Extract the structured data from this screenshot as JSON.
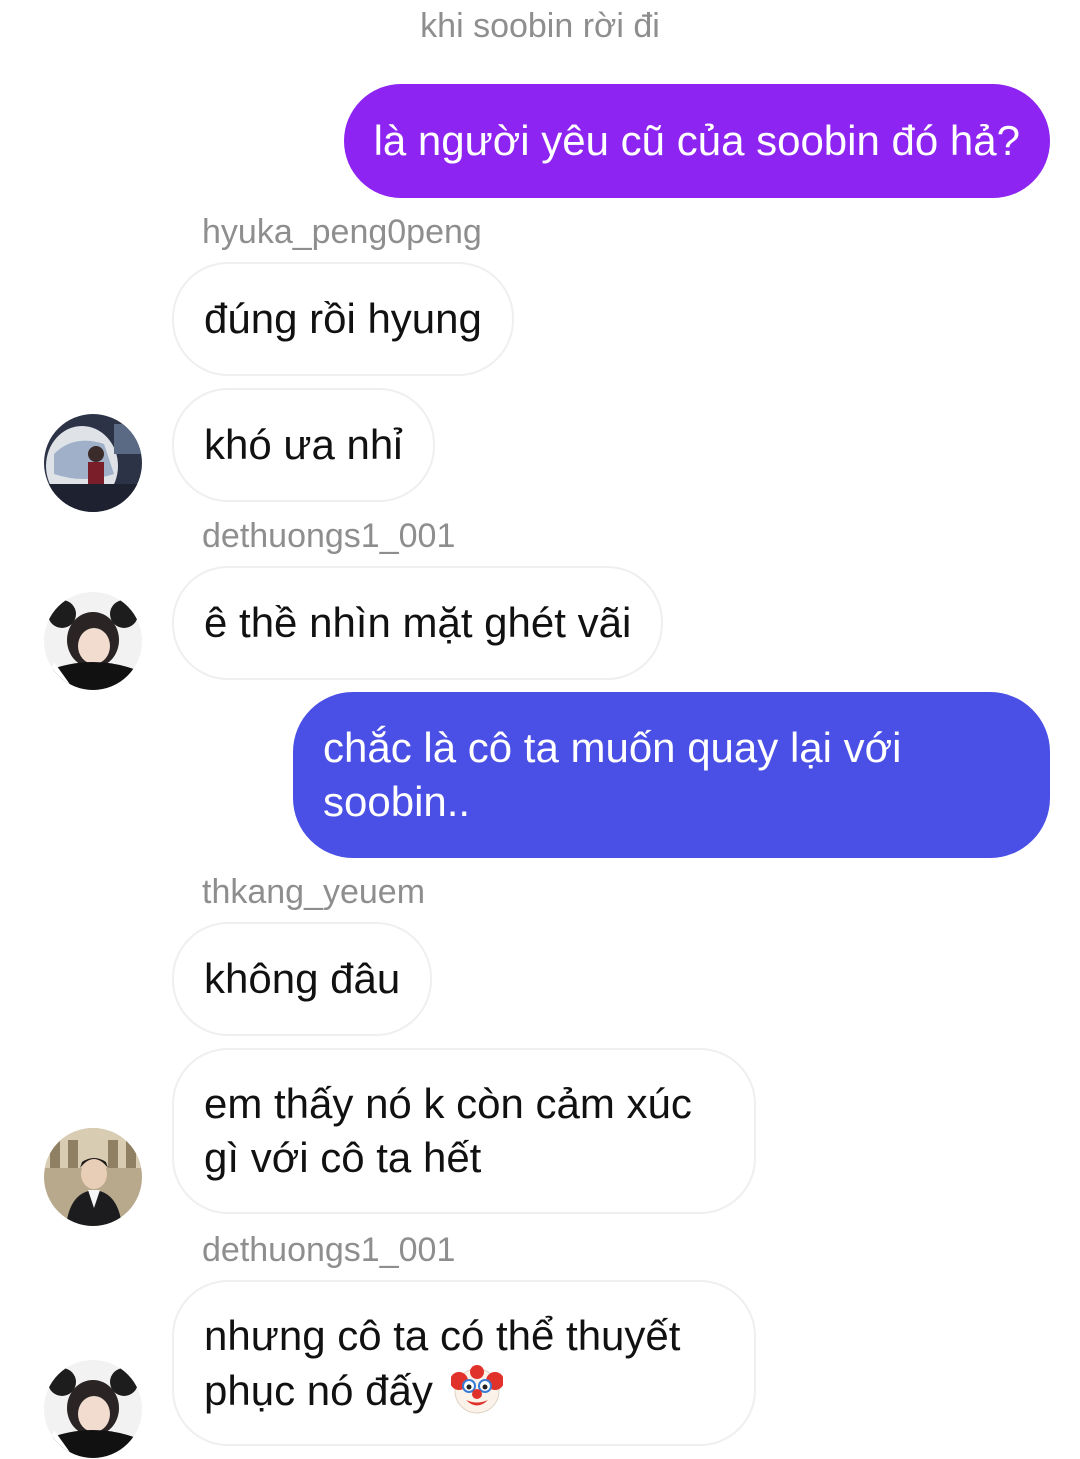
{
  "header": {
    "context_text": "khi soobin rời đi"
  },
  "messages": [
    {
      "type": "outgoing",
      "text": "là người yêu cũ của soobin đó hả?"
    },
    {
      "type": "sender",
      "name": "hyuka_peng0peng"
    },
    {
      "type": "incoming",
      "text": "đúng rồi hyung"
    },
    {
      "type": "incoming",
      "text": "khó ưa nhỉ",
      "avatar": "avatar-hyuka"
    },
    {
      "type": "sender",
      "name": "dethuongs1_001"
    },
    {
      "type": "incoming",
      "text": "ê thề nhìn mặt ghét vãi",
      "avatar": "avatar-dethuongs"
    },
    {
      "type": "outgoing",
      "line1": "chắc là cô ta muốn quay lại với",
      "line2": "soobin.."
    },
    {
      "type": "sender",
      "name": "thkang_yeuem"
    },
    {
      "type": "incoming",
      "text": "không đâu"
    },
    {
      "type": "incoming",
      "line1": "em thấy nó k còn cảm xúc",
      "line2": "gì với cô ta hết",
      "avatar": "avatar-thkang"
    },
    {
      "type": "sender",
      "name": "dethuongs1_001"
    },
    {
      "type": "incoming",
      "line1": "nhưng cô ta có thể thuyết",
      "line2": "phục nó đấy",
      "emoji": "clown-face-emoji",
      "avatar": "avatar-dethuongs"
    }
  ],
  "colors": {
    "outgoing_purple": "#8d24f2",
    "outgoing_blue": "#4a4fe6",
    "incoming_border": "#efefef",
    "meta_gray": "#8e8e8e"
  }
}
